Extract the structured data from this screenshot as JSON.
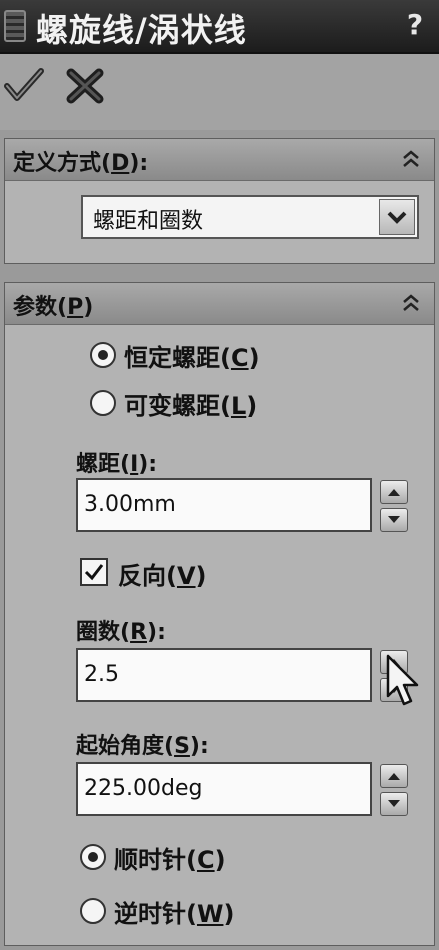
{
  "window": {
    "title": "螺旋线/涡状线",
    "help_label": "?"
  },
  "actions": {
    "ok_icon": "checkmark-icon",
    "cancel_icon": "x-icon"
  },
  "define": {
    "title": "定义方式(",
    "title_key": "D",
    "title_end": "):",
    "selected": "螺距和圈数"
  },
  "params": {
    "title": "参数(",
    "title_key": "P",
    "title_end": ")",
    "constant_pitch": {
      "label": "恒定螺距(",
      "key": "C",
      "end": ")",
      "selected": true
    },
    "variable_pitch": {
      "label": "可变螺距(",
      "key": "L",
      "end": ")",
      "selected": false
    },
    "pitch": {
      "label": "螺距(",
      "key": "I",
      "end": "):",
      "value": "3.00mm"
    },
    "reverse": {
      "label": "反向(",
      "key": "V",
      "end": ")",
      "checked": true
    },
    "revolutions": {
      "label": "圈数(",
      "key": "R",
      "end": "):",
      "value": "2.5"
    },
    "start_angle": {
      "label": "起始角度(",
      "key": "S",
      "end": "):",
      "value": "225.00deg"
    },
    "clockwise": {
      "label": "顺时针(",
      "key": "C",
      "end": ")",
      "selected": true
    },
    "counterclockwise": {
      "label": "逆时针(",
      "key": "W",
      "end": ")",
      "selected": false
    }
  },
  "colors": {
    "title_bg": "#222222",
    "panel_bg": "#b3b3b3",
    "header_bg": "#9a9a9a"
  }
}
